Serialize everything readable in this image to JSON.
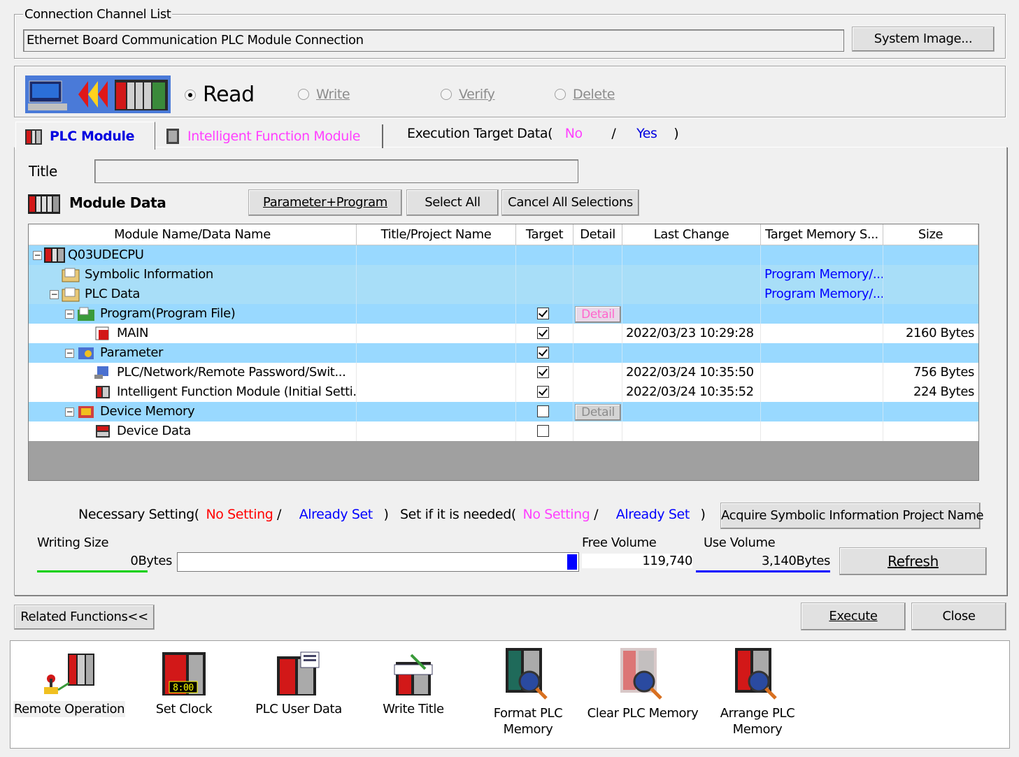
{
  "connection": {
    "legend": "Connection Channel List",
    "channel_text": "Ethernet Board Communication PLC Module Connection",
    "system_image_button": "System Image..."
  },
  "operation": {
    "options": [
      {
        "label": "Read",
        "selected": true
      },
      {
        "label": "Write",
        "selected": false
      },
      {
        "label": "Verify",
        "selected": false
      },
      {
        "label": "Delete",
        "selected": false
      }
    ]
  },
  "tabs": [
    {
      "label": "PLC Module",
      "active": true
    },
    {
      "label": "Intelligent Function Module",
      "active": false
    }
  ],
  "execution_target": {
    "prefix": "Execution Target Data(",
    "no": "No",
    "slash": "/",
    "yes": "Yes",
    "suffix": ")"
  },
  "title_field": {
    "label": "Title",
    "value": ""
  },
  "module_data": {
    "label": "Module Data",
    "buttons": [
      "Parameter+Program",
      "Select All",
      "Cancel All Selections"
    ]
  },
  "grid": {
    "headers": [
      "Module Name/Data Name",
      "Title/Project Name",
      "Target",
      "Detail",
      "Last Change",
      "Target Memory S...",
      "Size"
    ],
    "rows": [
      {
        "name": "Q03UDECPU",
        "title": "",
        "target": null,
        "detail": "",
        "last_change": "",
        "memory": "",
        "size": ""
      },
      {
        "name": "Symbolic Information",
        "title": "",
        "target": null,
        "detail": "",
        "last_change": "",
        "memory": "Program Memory/...",
        "size": ""
      },
      {
        "name": "PLC Data",
        "title": "",
        "target": null,
        "detail": "",
        "last_change": "",
        "memory": "Program Memory/...",
        "size": ""
      },
      {
        "name": "Program(Program File)",
        "title": "",
        "target": true,
        "detail": "Detail",
        "last_change": "",
        "memory": "",
        "size": ""
      },
      {
        "name": "MAIN",
        "title": "",
        "target": true,
        "detail": "",
        "last_change": "2022/03/23 10:29:28",
        "memory": "",
        "size": "2160 Bytes"
      },
      {
        "name": "Parameter",
        "title": "",
        "target": true,
        "detail": "",
        "last_change": "",
        "memory": "",
        "size": ""
      },
      {
        "name": "PLC/Network/Remote Password/Swit...",
        "title": "",
        "target": true,
        "detail": "",
        "last_change": "2022/03/24 10:35:50",
        "memory": "",
        "size": "756 Bytes"
      },
      {
        "name": "Intelligent Function Module (Initial Setti...",
        "title": "",
        "target": true,
        "detail": "",
        "last_change": "2022/03/24 10:35:52",
        "memory": "",
        "size": "224 Bytes"
      },
      {
        "name": "Device Memory",
        "title": "",
        "target": false,
        "detail": "Detail",
        "last_change": "",
        "memory": "",
        "size": ""
      },
      {
        "name": "Device Data",
        "title": "",
        "target": false,
        "detail": "",
        "last_change": "",
        "memory": "",
        "size": ""
      }
    ]
  },
  "legend_info": {
    "necessary_prefix": "Necessary Setting(",
    "necessary_no": "No Setting",
    "slash": "/",
    "necessary_set": "Already Set",
    "close_paren": ")",
    "ifneeded_prefix": "Set if it is needed(",
    "ifneeded_no": "No Setting",
    "ifneeded_set": "Already Set",
    "acquire_button": "Acquire Symbolic Information Project Name"
  },
  "sizes": {
    "writing_size_label": "Writing Size",
    "writing_size_value": "0Bytes",
    "writing_fraction": 0,
    "free_volume_label": "Free Volume",
    "free_volume_value": "119,740",
    "use_volume_label": "Use Volume",
    "use_volume_value": "3,140Bytes",
    "refresh_button": "Refresh"
  },
  "bottom_buttons": {
    "related": "Related Functions<<",
    "execute": "Execute",
    "close": "Close"
  },
  "related_functions": [
    {
      "label": "Remote Operation",
      "icon": "remote-operation-icon"
    },
    {
      "label": "Set Clock",
      "icon": "set-clock-icon",
      "clock_text": "8:00"
    },
    {
      "label": "PLC User Data",
      "icon": "plc-user-data-icon"
    },
    {
      "label": "Write Title",
      "icon": "write-title-icon"
    },
    {
      "label": "Format PLC\nMemory",
      "icon": "format-plc-memory-icon"
    },
    {
      "label": "Clear PLC Memory",
      "icon": "clear-plc-memory-icon"
    },
    {
      "label": "Arrange PLC\nMemory",
      "icon": "arrange-plc-memory-icon"
    }
  ],
  "colors": {
    "row_blue": "#99d9ff",
    "row_blue_light": "#a8def8",
    "no_red": "#ff0000",
    "no_pink": "#ff40ff",
    "set_blue": "#0000ff",
    "tab_blue": "#0000e0"
  }
}
